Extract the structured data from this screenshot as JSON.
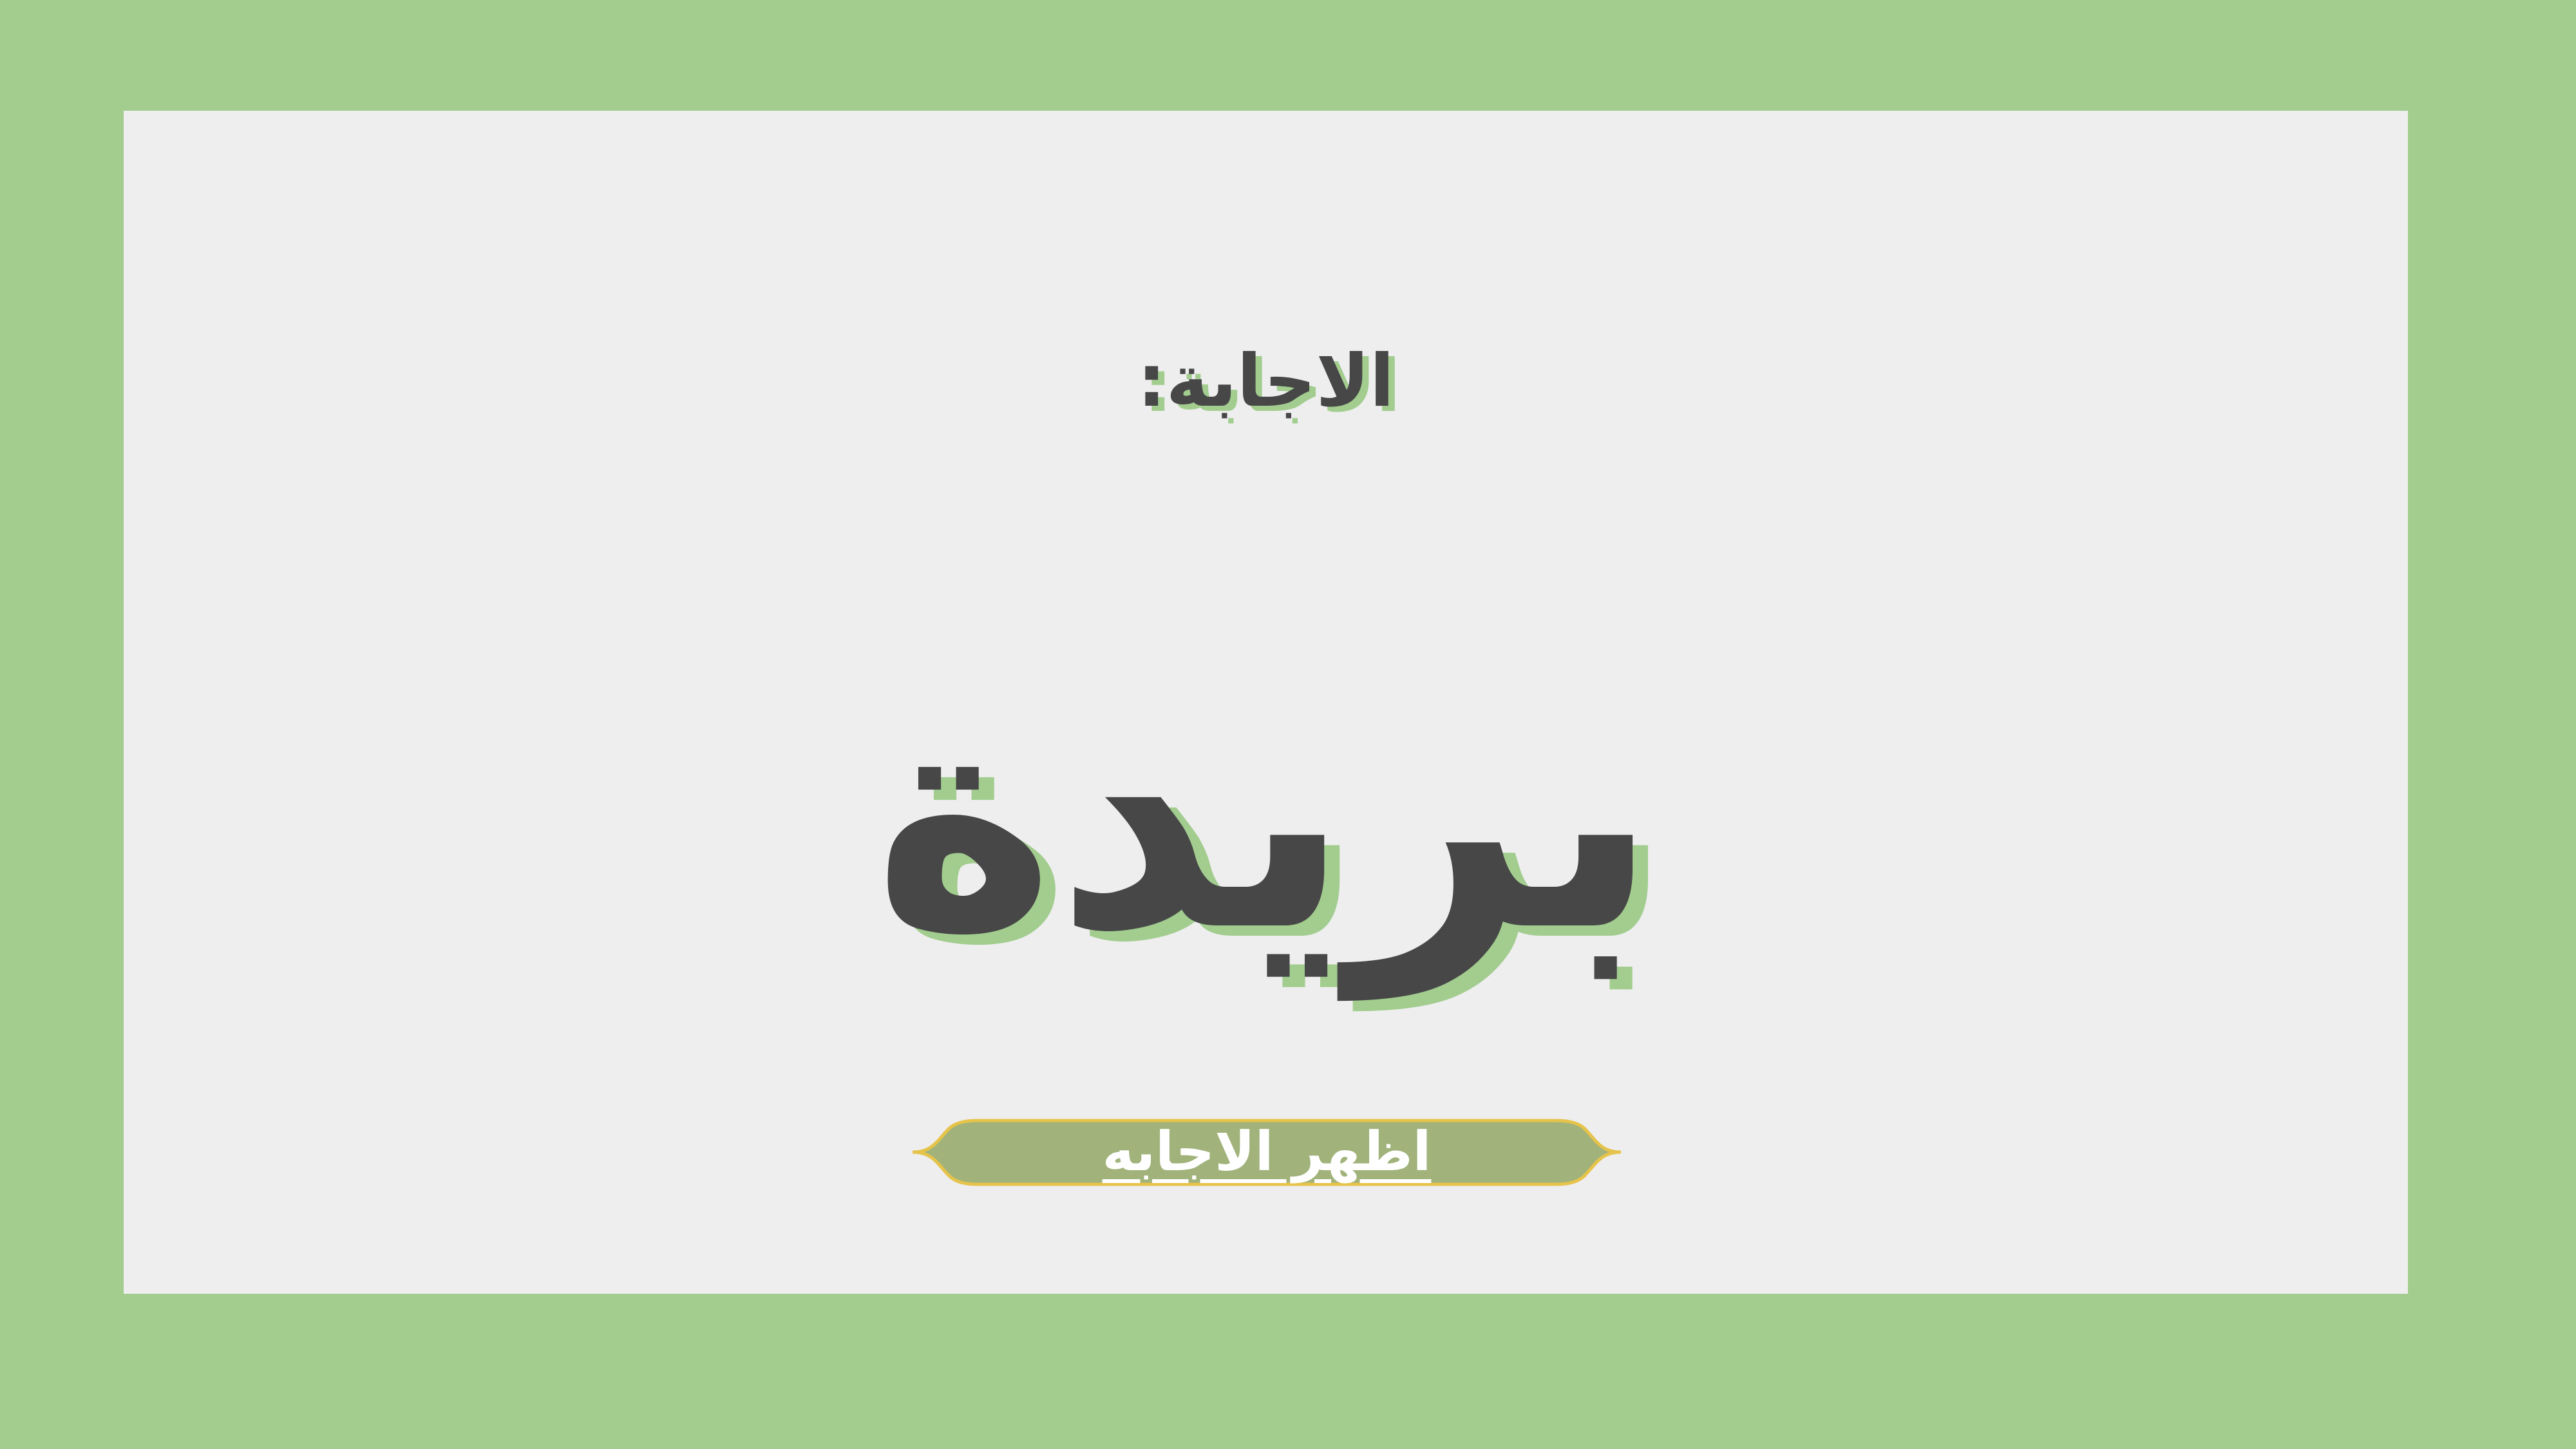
{
  "slide": {
    "heading": "الاجابة:",
    "answer": "بريدة",
    "button_label": "اظهر الاجابه"
  },
  "colors": {
    "outer_background": "#a2cd8f",
    "panel_background": "#eeeeee",
    "text": "#474747",
    "text_shadow": "#a2cd8f",
    "button_fill": "#a1b37b",
    "button_border": "#e6c34a",
    "button_text": "#ffffff"
  }
}
